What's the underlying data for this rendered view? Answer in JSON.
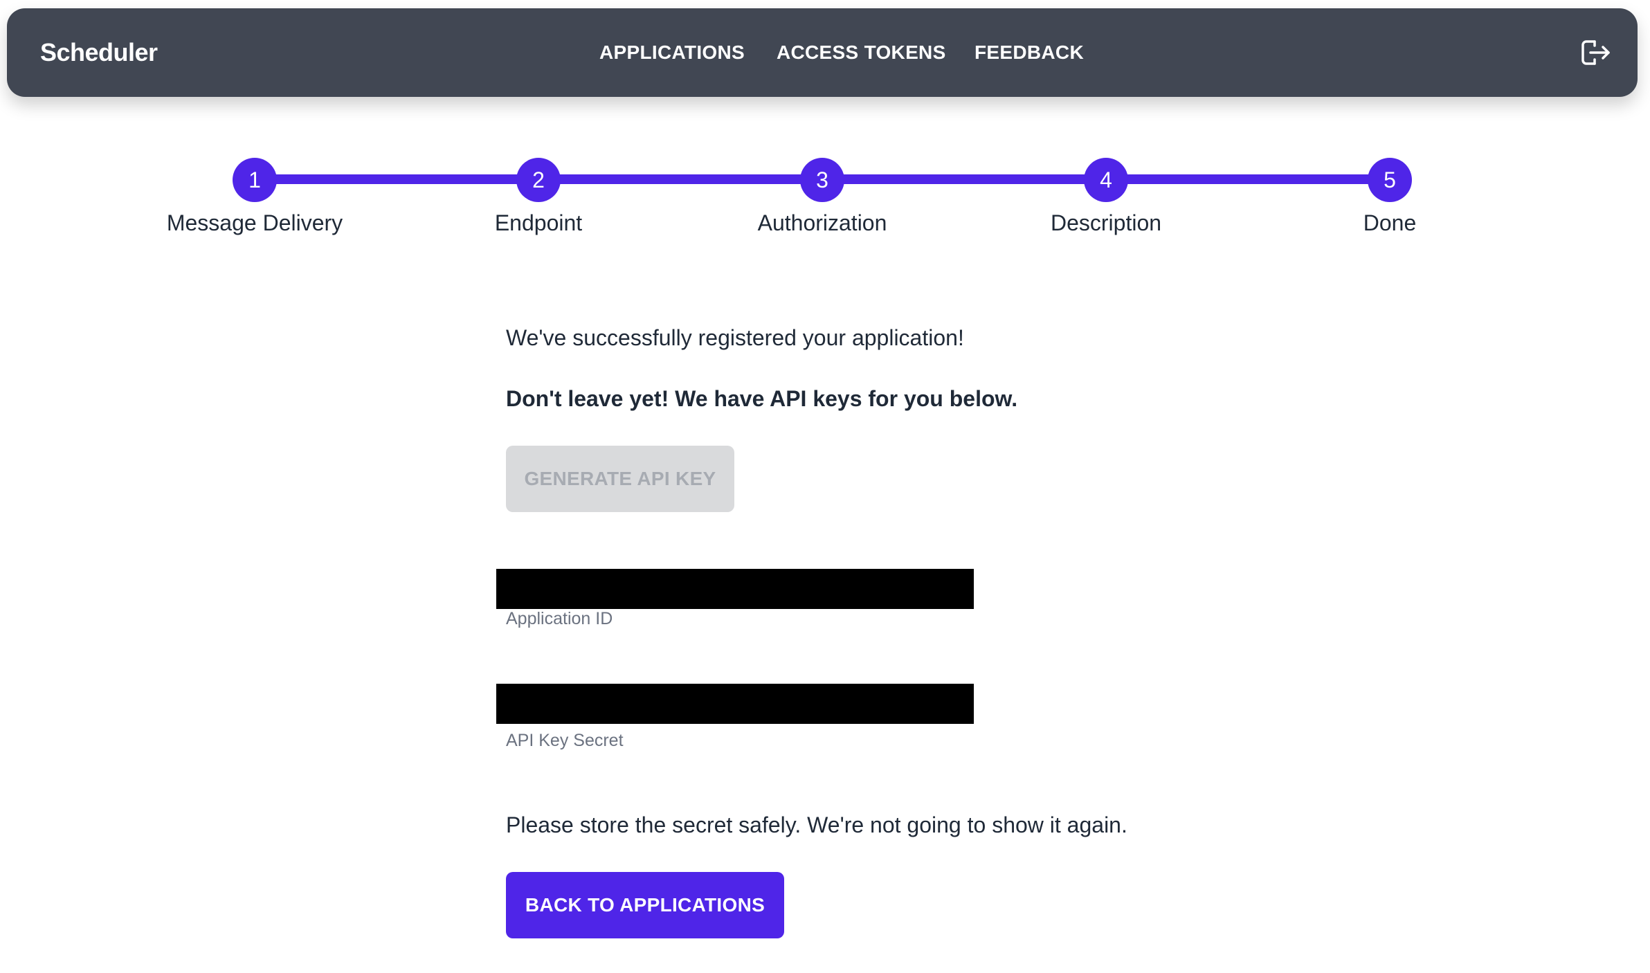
{
  "nav": {
    "brand": "Scheduler",
    "links": [
      "APPLICATIONS",
      "ACCESS TOKENS",
      "FEEDBACK"
    ],
    "logout_icon": "logout-icon"
  },
  "stepper": {
    "steps": [
      {
        "number": "1",
        "label": "Message Delivery"
      },
      {
        "number": "2",
        "label": "Endpoint"
      },
      {
        "number": "3",
        "label": "Authorization"
      },
      {
        "number": "4",
        "label": "Description"
      },
      {
        "number": "5",
        "label": "Done"
      }
    ],
    "accent_color": "#4f25e8"
  },
  "main": {
    "success_message": "We've successfully registered your application!",
    "warning_message": "Don't leave yet! We have API keys for you below.",
    "generate_button_label": "GENERATE API KEY",
    "fields": [
      {
        "caption": "Application ID"
      },
      {
        "caption": "API Key Secret"
      }
    ],
    "store_note": "Please store the secret safely. We're not going to show it again.",
    "back_button_label": "BACK TO APPLICATIONS"
  },
  "colors": {
    "navbar": "#414753",
    "accent": "#4f25e8",
    "disabled_button": "#d9dadc"
  }
}
